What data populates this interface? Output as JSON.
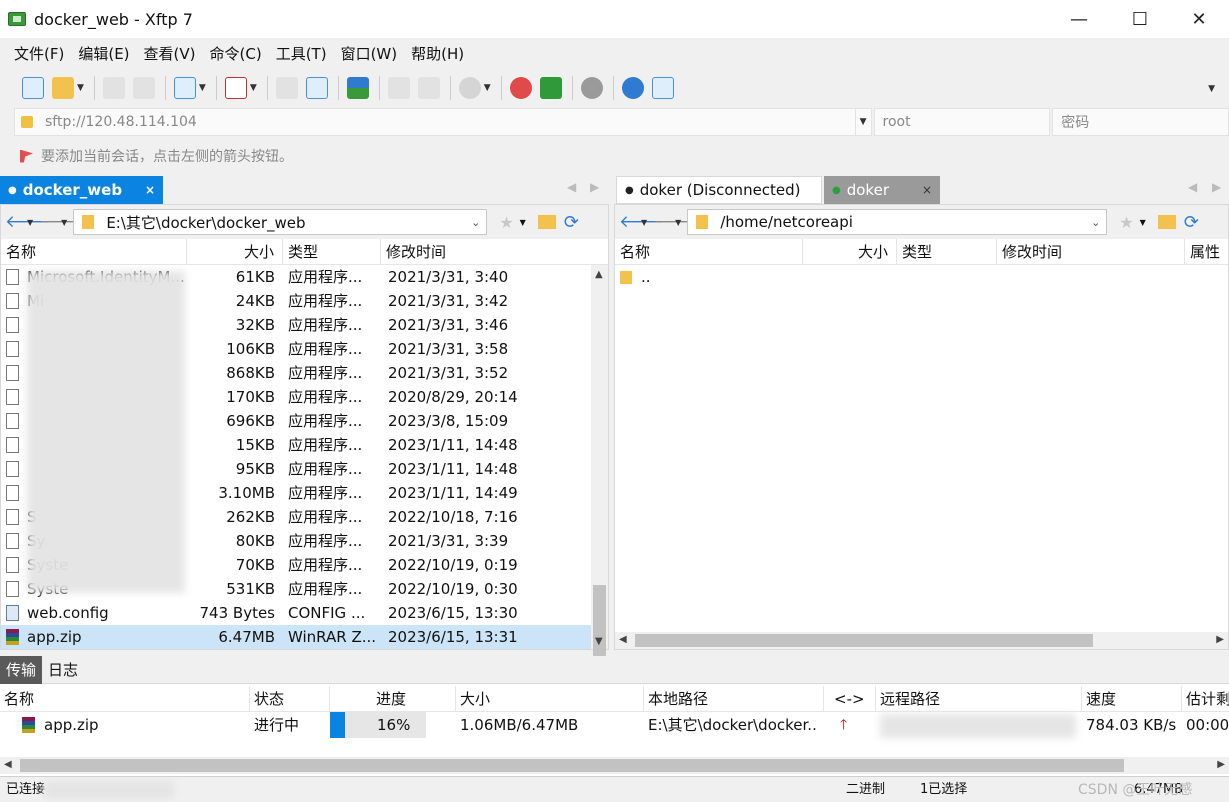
{
  "window": {
    "title": "docker_web - Xftp 7",
    "minimize": "—",
    "maximize": "☐",
    "close": "✕"
  },
  "menu": [
    "文件(F)",
    "编辑(E)",
    "查看(V)",
    "命令(C)",
    "工具(T)",
    "窗口(W)",
    "帮助(H)"
  ],
  "address": {
    "host": "sftp://120.48.114.104",
    "user_placeholder": "root",
    "password_placeholder": "密码"
  },
  "hint": "要添加当前会话，点击左侧的箭头按钮。",
  "left_pane": {
    "tab_label": "docker_web",
    "tab_dot": "●",
    "tab_close": "×",
    "path": "E:\\其它\\docker\\docker_web",
    "columns": [
      "名称",
      "大小",
      "类型",
      "修改时间"
    ],
    "files": [
      {
        "name": "Microsoft.IdentityM...",
        "size": "61KB",
        "type": "应用程序...",
        "modified": "2021/3/31, 3:40",
        "icon": "dll-icon"
      },
      {
        "name": "Mi",
        "size": "24KB",
        "type": "应用程序...",
        "modified": "2021/3/31, 3:42",
        "icon": "dll-icon"
      },
      {
        "name": "",
        "size": "32KB",
        "type": "应用程序...",
        "modified": "2021/3/31, 3:46",
        "icon": "dll-icon"
      },
      {
        "name": "",
        "size": "106KB",
        "type": "应用程序...",
        "modified": "2021/3/31, 3:58",
        "icon": "dll-icon"
      },
      {
        "name": "",
        "size": "868KB",
        "type": "应用程序...",
        "modified": "2021/3/31, 3:52",
        "icon": "dll-icon"
      },
      {
        "name": "",
        "size": "170KB",
        "type": "应用程序...",
        "modified": "2020/8/29, 20:14",
        "icon": "dll-icon"
      },
      {
        "name": "",
        "size": "696KB",
        "type": "应用程序...",
        "modified": "2023/3/8, 15:09",
        "icon": "dll-icon"
      },
      {
        "name": "",
        "size": "15KB",
        "type": "应用程序...",
        "modified": "2023/1/11, 14:48",
        "icon": "dll-icon"
      },
      {
        "name": "",
        "size": "95KB",
        "type": "应用程序...",
        "modified": "2023/1/11, 14:48",
        "icon": "dll-icon"
      },
      {
        "name": "",
        "size": "3.10MB",
        "type": "应用程序...",
        "modified": "2023/1/11, 14:49",
        "icon": "dll-icon"
      },
      {
        "name": "S",
        "size": "262KB",
        "type": "应用程序...",
        "modified": "2022/10/18, 7:16",
        "icon": "dll-icon"
      },
      {
        "name": "Sy",
        "size": "80KB",
        "type": "应用程序...",
        "modified": "2021/3/31, 3:39",
        "icon": "dll-icon"
      },
      {
        "name": "Syste",
        "size": "70KB",
        "type": "应用程序...",
        "modified": "2022/10/19, 0:19",
        "icon": "dll-icon"
      },
      {
        "name": "Syste",
        "size": "531KB",
        "type": "应用程序...",
        "modified": "2022/10/19, 0:30",
        "icon": "dll-icon"
      },
      {
        "name": "web.config",
        "size": "743 Bytes",
        "type": "CONFIG ...",
        "modified": "2023/6/15, 13:30",
        "icon": "config-file-icon"
      },
      {
        "name": "app.zip",
        "size": "6.47MB",
        "type": "WinRAR Z...",
        "modified": "2023/6/15, 13:31",
        "icon": "winrar-archive-icon",
        "selected": true
      }
    ]
  },
  "right_pane": {
    "tab1_label": "doker (Disconnected)",
    "tab2_label": "doker",
    "tab_dot": "●",
    "tab_close": "×",
    "path": "/home/netcoreapi",
    "columns": [
      "名称",
      "大小",
      "类型",
      "修改时间",
      "属性"
    ],
    "files": [
      {
        "name": ".."
      }
    ]
  },
  "transfer": {
    "tabs": [
      "传输",
      "日志"
    ],
    "columns": [
      "名称",
      "状态",
      "进度",
      "大小",
      "本地路径",
      "<->",
      "远程路径",
      "速度",
      "估计剩"
    ],
    "rows": [
      {
        "name": "app.zip",
        "status": "进行中",
        "progress_percent": 16,
        "progress_text": "16%",
        "size": "1.06MB/6.47MB",
        "local_path": "E:\\其它\\docker\\docker..",
        "direction": "upload-arrow-icon",
        "speed": "784.03 KB/s",
        "eta": "00:00:"
      }
    ]
  },
  "status": {
    "left": "已连接",
    "mode": "二进制",
    "selection": "1已选择",
    "size": "6.47MB",
    "watermark": "CSDN @王叶无感"
  },
  "colors": {
    "accent": "#0a84e0",
    "selection": "#cce4f7"
  }
}
